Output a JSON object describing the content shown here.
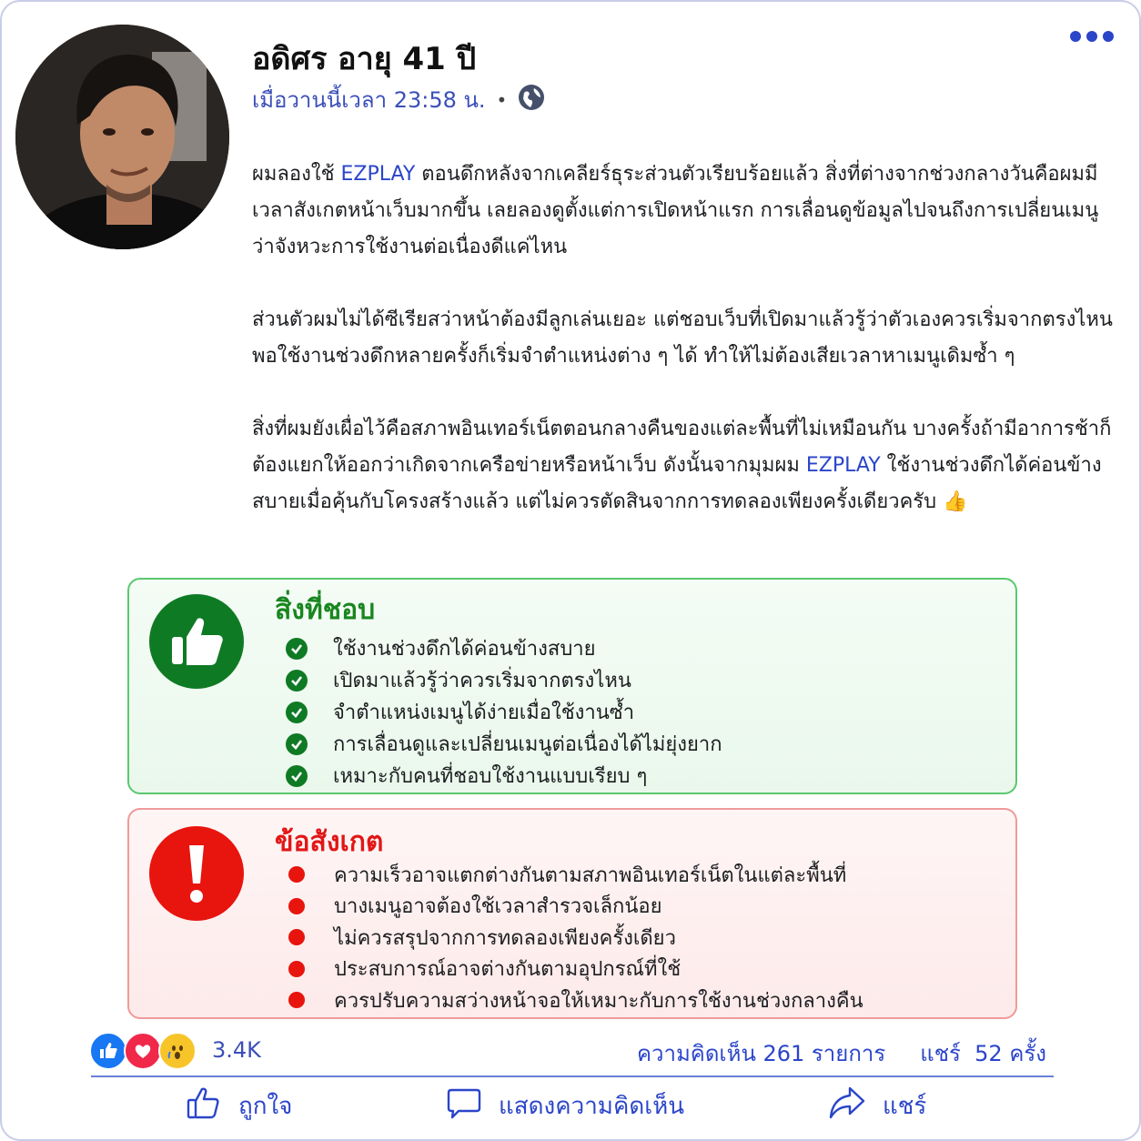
{
  "post": {
    "author": "อดิศร อายุ 41 ปี",
    "timestamp": "เมื่อวานนี้เวลา 23:58 น.",
    "separator": "•",
    "privacy_icon": "globe-icon",
    "more_icon": "more-options-icon",
    "paragraphs": [
      {
        "segments": [
          {
            "text": "ผมลองใช้ ",
            "brand": false
          },
          {
            "text": "EZPLAY",
            "brand": true
          },
          {
            "text": " ตอนดึกหลังจากเคลียร์ธุระส่วนตัวเรียบร้อยแล้ว สิ่งที่ต่างจากช่วงกลางวันคือผมมีเวลาสังเกตหน้าเว็บมากขึ้น เลยลองดูตั้งแต่การเปิดหน้าแรก การเลื่อนดูข้อมูลไปจนถึงการเปลี่ยนเมนูว่าจังหวะการใช้งานต่อเนื่องดีแค่ไหน",
            "brand": false
          }
        ]
      },
      {
        "segments": [
          {
            "text": "ส่วนตัวผมไม่ได้ซีเรียสว่าหน้าต้องมีลูกเล่นเยอะ แต่ชอบเว็บที่เปิดมาแล้วรู้ว่าตัวเองควรเริ่มจากตรงไหน พอใช้งานช่วงดึกหลายครั้งก็เริ่มจำตำแหน่งต่าง ๆ ได้ ทำให้ไม่ต้องเสียเวลาหาเมนูเดิมซ้ำ ๆ",
            "brand": false
          }
        ]
      },
      {
        "segments": [
          {
            "text": "สิ่งที่ผมยังเผื่อไว้คือสภาพอินเทอร์เน็ตตอนกลางคืนของแต่ละพื้นที่ไม่เหมือนกัน บางครั้งถ้ามีอาการช้าก็ต้องแยกให้ออกว่าเกิดจากเครือข่ายหรือหน้าเว็บ ดังนั้นจากมุมผม ",
            "brand": false
          },
          {
            "text": "EZPLAY",
            "brand": true
          },
          {
            "text": " ใช้งานช่วงดึกได้ค่อนข้างสบายเมื่อคุ้นกับโครงสร้างแล้ว แต่ไม่ควรตัดสินจากการทดลองเพียงครั้งเดียวครับ 👍",
            "brand": false
          }
        ]
      }
    ]
  },
  "pros": {
    "title": "สิ่งที่ชอบ",
    "icon": "thumbs-up-icon",
    "items": [
      "ใช้งานช่วงดึกได้ค่อนข้างสบาย",
      "เปิดมาแล้วรู้ว่าควรเริ่มจากตรงไหน",
      "จำตำแหน่งเมนูได้ง่ายเมื่อใช้งานซ้ำ",
      "การเลื่อนดูและเปลี่ยนเมนูต่อเนื่องได้ไม่ยุ่งยาก",
      "เหมาะกับคนที่ชอบใช้งานแบบเรียบ ๆ"
    ]
  },
  "cons": {
    "title": "ข้อสังเกต",
    "icon": "exclamation-icon",
    "items": [
      "ความเร็วอาจแตกต่างกันตามสภาพอินเทอร์เน็ตในแต่ละพื้นที่",
      "บางเมนูอาจต้องใช้เวลาสำรวจเล็กน้อย",
      "ไม่ควรสรุปจากการทดลองเพียงครั้งเดียว",
      "ประสบการณ์อาจต่างกันตามอุปกรณ์ที่ใช้",
      "ควรปรับความสว่างหน้าจอให้เหมาะกับการใช้งานช่วงกลางคืน"
    ]
  },
  "stats": {
    "reactions": [
      "like-reaction-icon",
      "love-reaction-icon",
      "wow-reaction-icon"
    ],
    "reaction_count": "3.4K",
    "comments": "ความคิดเห็น 261 รายการ",
    "shares": "แชร์  52 ครั้ง"
  },
  "actions": {
    "like": "ถูกใจ",
    "comment": "แสดงความคิดเห็น",
    "share": "แชร์"
  },
  "colors": {
    "brand": "#2b45c9",
    "pros_green": "#0f7a24",
    "cons_red": "#e8140e"
  }
}
